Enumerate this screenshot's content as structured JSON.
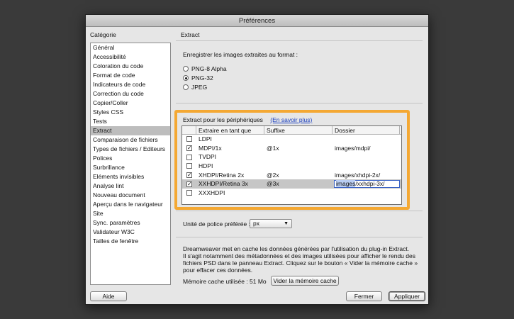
{
  "window": {
    "title": "Préférences"
  },
  "categories": {
    "heading": "Catégorie",
    "items": [
      "Général",
      "Accessibilité",
      "Coloration du code",
      "Format de code",
      "Indicateurs de code",
      "Correction du code",
      "Copier/Coller",
      "Styles CSS",
      "Tests",
      "Extract",
      "Comparaison de fichiers",
      "Types de fichiers / Editeurs",
      "Polices",
      "Surbrillance",
      "Eléments invisibles",
      "Analyse lint",
      "Nouveau document",
      "Aperçu dans le navigateur",
      "Site",
      "Sync. paramètres",
      "Validateur W3C",
      "Tailles de fenêtre"
    ],
    "selected_index": 9
  },
  "panel": {
    "title": "Extract",
    "format_label": "Enregistrer les images extraites au format :",
    "formats": [
      {
        "label": "PNG-8 Alpha",
        "selected": false
      },
      {
        "label": "PNG-32",
        "selected": true
      },
      {
        "label": "JPEG",
        "selected": false
      }
    ],
    "devices_label": "Extract pour les périphériques",
    "learn_more": "(En savoir plus)",
    "table": {
      "headers": [
        "Extraire en tant que",
        "Suffixe",
        "Dossier"
      ],
      "rows": [
        {
          "checked": false,
          "name": "LDPI",
          "suffix": "",
          "folder": ""
        },
        {
          "checked": true,
          "name": "MDPI/1x",
          "suffix": "@1x",
          "folder": "images/mdpi/"
        },
        {
          "checked": false,
          "name": "TVDPI",
          "suffix": "",
          "folder": ""
        },
        {
          "checked": false,
          "name": "HDPI",
          "suffix": "",
          "folder": ""
        },
        {
          "checked": true,
          "name": "XHDPI/Retina 2x",
          "suffix": "@2x",
          "folder": "images/xhdpi-2x/"
        },
        {
          "checked": true,
          "name": "XXHDPI/Retina 3x",
          "suffix": "@3x",
          "folder_selected_part": "images",
          "folder_rest": "/xxhdpi-3x/"
        },
        {
          "checked": false,
          "name": "XXXHDPI",
          "suffix": "",
          "folder": ""
        }
      ]
    },
    "font_unit_label": "Unité de police préférée :",
    "font_unit_value": "px",
    "description": [
      "Dreamweaver met en cache les données générées par l'utilisation du plug-in Extract.",
      "Il s'agit notamment des métadonnées et des images utilisées pour afficher le rendu des",
      "fichiers PSD dans le panneau Extract. Cliquez sur le bouton « Vider la mémoire cache »",
      "pour effacer ces données."
    ],
    "cache_label": "Mémoire cache utilisée : 51 Mo",
    "clear_cache_button": "Vider la mémoire cache"
  },
  "footer": {
    "help": "Aide",
    "close": "Fermer",
    "apply": "Appliquer"
  }
}
